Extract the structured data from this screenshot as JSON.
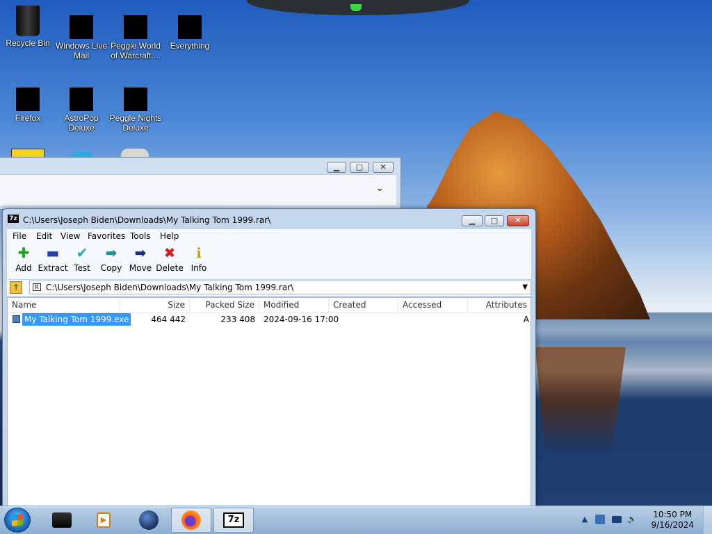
{
  "desktop": {
    "icons": [
      {
        "label": "Recycle Bin"
      },
      {
        "label": "Windows Live Mail"
      },
      {
        "label": "Peggle World of Warcraft ..."
      },
      {
        "label": "Everything"
      },
      {
        "label": "Firefox"
      },
      {
        "label": "AstroPop Deluxe"
      },
      {
        "label": "Peggle Nights Deluxe"
      }
    ]
  },
  "background_window": {
    "minimize": "▁",
    "maximize": "□",
    "close": "✕",
    "chevron": "⌄"
  },
  "window": {
    "title": "C:\\Users\\Joseph Biden\\Downloads\\My Talking Tom 1999.rar\\",
    "title_icon": "7z",
    "caption": {
      "minimize": "▁",
      "maximize": "□",
      "close": "✕"
    },
    "menu": [
      "File",
      "Edit",
      "View",
      "Favorites",
      "Tools",
      "Help"
    ],
    "toolbar": [
      {
        "label": "Add",
        "icon": "add-icon",
        "glyph": "✚",
        "color": "#1fa51f"
      },
      {
        "label": "Extract",
        "icon": "extract-icon",
        "glyph": "▬",
        "color": "#1f3fb0"
      },
      {
        "label": "Test",
        "icon": "test-icon",
        "glyph": "✔",
        "color": "#1fa5a0"
      },
      {
        "label": "Copy",
        "icon": "copy-icon",
        "glyph": "➡",
        "color": "#1f9a8a"
      },
      {
        "label": "Move",
        "icon": "move-icon",
        "glyph": "➡",
        "color": "#1f2f8a"
      },
      {
        "label": "Delete",
        "icon": "delete-icon",
        "glyph": "✖",
        "color": "#d41c1c"
      },
      {
        "label": "Info",
        "icon": "info-icon",
        "glyph": "i",
        "color": "#c9a000"
      }
    ],
    "address": "C:\\Users\\Joseph Biden\\Downloads\\My Talking Tom 1999.rar\\",
    "columns": [
      "Name",
      "Size",
      "Packed Size",
      "Modified",
      "Created",
      "Accessed",
      "Attributes"
    ],
    "files": [
      {
        "name": "My Talking Tom 1999.exe",
        "size": "464 442",
        "packed": "233 408",
        "modified": "2024-09-16 17:00",
        "created": "",
        "accessed": "",
        "attributes": "A"
      }
    ]
  },
  "taskbar": {
    "buttons": [
      {
        "name": "file-manager-taskbar-button",
        "icon": "folder-icon"
      },
      {
        "name": "media-player-taskbar-button",
        "icon": "media-player-icon"
      },
      {
        "name": "globe-taskbar-button",
        "icon": "globe-icon"
      },
      {
        "name": "firefox-taskbar-button",
        "icon": "firefox-icon"
      },
      {
        "name": "7zip-taskbar-button",
        "icon": "7zip-icon",
        "label": "7z"
      }
    ],
    "tray_expand": "▲",
    "time": "10:50 PM",
    "date": "9/16/2024"
  }
}
